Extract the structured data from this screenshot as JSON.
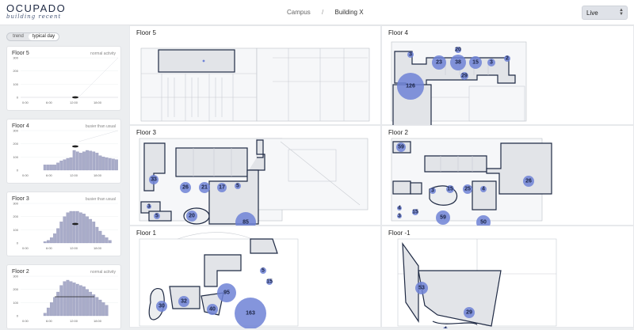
{
  "header": {
    "logo_name": "OCUPADO",
    "logo_sub": "building recent",
    "breadcrumb": [
      "Campus",
      "/",
      "Building X"
    ],
    "mode_select": "Live"
  },
  "sidebar": {
    "toggle": [
      "trend",
      "typical day"
    ],
    "x_ticks": [
      "0:00",
      "6:00",
      "12:00",
      "18:00"
    ],
    "y_ticks": [
      "0",
      "100",
      "200",
      "300"
    ],
    "cards": [
      {
        "floor": "Floor 5",
        "status": "normal activity",
        "bars": []
      },
      {
        "floor": "Floor 4",
        "status": "busier than usual",
        "bars": [
          0,
          0,
          0,
          0,
          0,
          0,
          0,
          40,
          40,
          40,
          40,
          55,
          70,
          80,
          90,
          95,
          150,
          140,
          130,
          140,
          150,
          145,
          140,
          130,
          110,
          100,
          95,
          90,
          85,
          80
        ]
      },
      {
        "floor": "Floor 3",
        "status": "busier than usual",
        "bars": [
          0,
          0,
          0,
          0,
          0,
          0,
          0,
          10,
          20,
          40,
          70,
          110,
          160,
          200,
          230,
          240,
          240,
          240,
          230,
          220,
          200,
          180,
          160,
          120,
          90,
          60,
          40,
          20,
          0,
          0
        ]
      },
      {
        "floor": "Floor 2",
        "status": "normal activity",
        "bars": [
          0,
          0,
          0,
          0,
          0,
          0,
          0,
          20,
          60,
          100,
          140,
          180,
          230,
          260,
          270,
          260,
          250,
          240,
          230,
          220,
          200,
          180,
          160,
          140,
          120,
          100,
          80,
          0,
          0,
          0
        ]
      }
    ]
  },
  "floors": [
    {
      "name": "Floor 5",
      "counts": []
    },
    {
      "name": "Floor 4",
      "counts": [
        "20",
        "3",
        "23",
        "38",
        "15",
        "3",
        "2",
        "29",
        "126"
      ]
    },
    {
      "name": "Floor 3",
      "counts": [
        "33",
        "26",
        "21",
        "17",
        "5",
        "3",
        "5",
        "20",
        "85"
      ]
    },
    {
      "name": "Floor 2",
      "counts": [
        "59",
        "3",
        "15",
        "25",
        "4",
        "26",
        "4",
        "3",
        "15",
        "59",
        "50"
      ]
    },
    {
      "name": "Floor 1",
      "counts": [
        "95",
        "5",
        "15",
        "30",
        "32",
        "40",
        "163"
      ]
    },
    {
      "name": "Floor -1",
      "counts": [
        "53",
        "29",
        "4"
      ]
    }
  ],
  "colors": {
    "accent": "#6e82d6",
    "outline": "#1f2a44",
    "zone": "#e2e4e8"
  }
}
